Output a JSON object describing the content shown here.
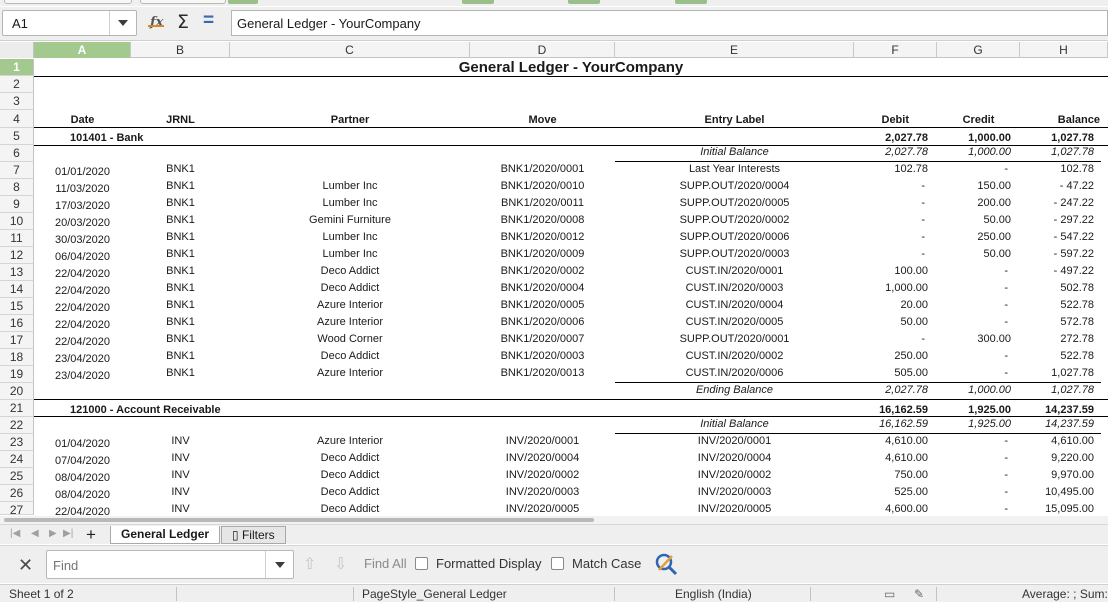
{
  "name_box": "A1",
  "formula_text": "General Ledger - YourCompany",
  "columns": [
    "A",
    "B",
    "C",
    "D",
    "E",
    "F",
    "G",
    "H"
  ],
  "rows": [
    "1",
    "2",
    "3",
    "4",
    "5",
    "6",
    "7",
    "8",
    "9",
    "10",
    "11",
    "12",
    "13",
    "14",
    "15",
    "16",
    "17",
    "18",
    "19",
    "20",
    "21",
    "22",
    "23",
    "24",
    "25",
    "26",
    "27"
  ],
  "sheet": {
    "title": "General Ledger - YourCompany",
    "headers": {
      "date": "Date",
      "jrnl": "JRNL",
      "partner": "Partner",
      "move": "Move",
      "entry": "Entry Label",
      "debit": "Debit",
      "credit": "Credit",
      "balance": "Balance"
    },
    "bank": {
      "account": "101401 - Bank",
      "debit": "2,027.78",
      "credit": "1,000.00",
      "balance": "1,027.78"
    },
    "bank_initial": {
      "label": "Initial Balance",
      "debit": "2,027.78",
      "credit": "1,000.00",
      "balance": "1,027.78"
    },
    "bank_rows": [
      {
        "date": "01/01/2020",
        "jrnl": "BNK1",
        "partner": "",
        "move": "BNK1/2020/0001",
        "entry": "Last Year Interests",
        "debit": "102.78",
        "credit": "-",
        "balance": "102.78"
      },
      {
        "date": "11/03/2020",
        "jrnl": "BNK1",
        "partner": "Lumber Inc",
        "move": "BNK1/2020/0010",
        "entry": "SUPP.OUT/2020/0004",
        "debit": "-",
        "credit": "150.00",
        "balance": "- 47.22"
      },
      {
        "date": "17/03/2020",
        "jrnl": "BNK1",
        "partner": "Lumber Inc",
        "move": "BNK1/2020/0011",
        "entry": "SUPP.OUT/2020/0005",
        "debit": "-",
        "credit": "200.00",
        "balance": "- 247.22"
      },
      {
        "date": "20/03/2020",
        "jrnl": "BNK1",
        "partner": "Gemini Furniture",
        "move": "BNK1/2020/0008",
        "entry": "SUPP.OUT/2020/0002",
        "debit": "-",
        "credit": "50.00",
        "balance": "- 297.22"
      },
      {
        "date": "30/03/2020",
        "jrnl": "BNK1",
        "partner": "Lumber Inc",
        "move": "BNK1/2020/0012",
        "entry": "SUPP.OUT/2020/0006",
        "debit": "-",
        "credit": "250.00",
        "balance": "- 547.22"
      },
      {
        "date": "06/04/2020",
        "jrnl": "BNK1",
        "partner": "Lumber Inc",
        "move": "BNK1/2020/0009",
        "entry": "SUPP.OUT/2020/0003",
        "debit": "-",
        "credit": "50.00",
        "balance": "- 597.22"
      },
      {
        "date": "22/04/2020",
        "jrnl": "BNK1",
        "partner": "Deco Addict",
        "move": "BNK1/2020/0002",
        "entry": "CUST.IN/2020/0001",
        "debit": "100.00",
        "credit": "-",
        "balance": "- 497.22"
      },
      {
        "date": "22/04/2020",
        "jrnl": "BNK1",
        "partner": "Deco Addict",
        "move": "BNK1/2020/0004",
        "entry": "CUST.IN/2020/0003",
        "debit": "1,000.00",
        "credit": "-",
        "balance": "502.78"
      },
      {
        "date": "22/04/2020",
        "jrnl": "BNK1",
        "partner": "Azure Interior",
        "move": "BNK1/2020/0005",
        "entry": "CUST.IN/2020/0004",
        "debit": "20.00",
        "credit": "-",
        "balance": "522.78"
      },
      {
        "date": "22/04/2020",
        "jrnl": "BNK1",
        "partner": "Azure Interior",
        "move": "BNK1/2020/0006",
        "entry": "CUST.IN/2020/0005",
        "debit": "50.00",
        "credit": "-",
        "balance": "572.78"
      },
      {
        "date": "22/04/2020",
        "jrnl": "BNK1",
        "partner": "Wood Corner",
        "move": "BNK1/2020/0007",
        "entry": "SUPP.OUT/2020/0001",
        "debit": "-",
        "credit": "300.00",
        "balance": "272.78"
      },
      {
        "date": "23/04/2020",
        "jrnl": "BNK1",
        "partner": "Deco Addict",
        "move": "BNK1/2020/0003",
        "entry": "CUST.IN/2020/0002",
        "debit": "250.00",
        "credit": "-",
        "balance": "522.78"
      },
      {
        "date": "23/04/2020",
        "jrnl": "BNK1",
        "partner": "Azure Interior",
        "move": "BNK1/2020/0013",
        "entry": "CUST.IN/2020/0006",
        "debit": "505.00",
        "credit": "-",
        "balance": "1,027.78"
      }
    ],
    "bank_ending": {
      "label": "Ending Balance",
      "debit": "2,027.78",
      "credit": "1,000.00",
      "balance": "1,027.78"
    },
    "ar": {
      "account": "121000 - Account Receivable",
      "debit": "16,162.59",
      "credit": "1,925.00",
      "balance": "14,237.59"
    },
    "ar_initial": {
      "label": "Initial Balance",
      "debit": "16,162.59",
      "credit": "1,925.00",
      "balance": "14,237.59"
    },
    "ar_rows": [
      {
        "date": "01/04/2020",
        "jrnl": "INV",
        "partner": "Azure Interior",
        "move": "INV/2020/0001",
        "entry": "INV/2020/0001",
        "debit": "4,610.00",
        "credit": "-",
        "balance": "4,610.00"
      },
      {
        "date": "07/04/2020",
        "jrnl": "INV",
        "partner": "Deco Addict",
        "move": "INV/2020/0004",
        "entry": "INV/2020/0004",
        "debit": "4,610.00",
        "credit": "-",
        "balance": "9,220.00"
      },
      {
        "date": "08/04/2020",
        "jrnl": "INV",
        "partner": "Deco Addict",
        "move": "INV/2020/0002",
        "entry": "INV/2020/0002",
        "debit": "750.00",
        "credit": "-",
        "balance": "9,970.00"
      },
      {
        "date": "08/04/2020",
        "jrnl": "INV",
        "partner": "Deco Addict",
        "move": "INV/2020/0003",
        "entry": "INV/2020/0003",
        "debit": "525.00",
        "credit": "-",
        "balance": "10,495.00"
      },
      {
        "date": "22/04/2020",
        "jrnl": "INV",
        "partner": "Deco Addict",
        "move": "INV/2020/0005",
        "entry": "INV/2020/0005",
        "debit": "4,600.00",
        "credit": "-",
        "balance": "15,095.00"
      }
    ]
  },
  "tabs": [
    {
      "label": "General Ledger",
      "active": true
    },
    {
      "label": "Filters",
      "active": false
    }
  ],
  "filters_tab_glyph": "▯",
  "find": {
    "placeholder": "Find",
    "find_all": "Find All",
    "formatted_display": "Formatted Display",
    "match_case": "Match Case"
  },
  "status": {
    "sheet": "Sheet 1 of 2",
    "page_style": "PageStyle_General Ledger",
    "language": "English (India)",
    "summary": "Average: ; Sum:"
  },
  "icons": {
    "name_box_dropdown": "chevron-down-icon",
    "function_wizard": "function-wizard-icon",
    "sum": "sigma-icon",
    "formula": "equals-icon",
    "close_find": "close-icon",
    "find_previous": "arrow-up-icon",
    "find_next": "arrow-down-icon",
    "find_replace": "find-replace-icon"
  },
  "colors": {
    "selection_header": "#a3c98f",
    "toolbar_bg": "#efefef"
  }
}
